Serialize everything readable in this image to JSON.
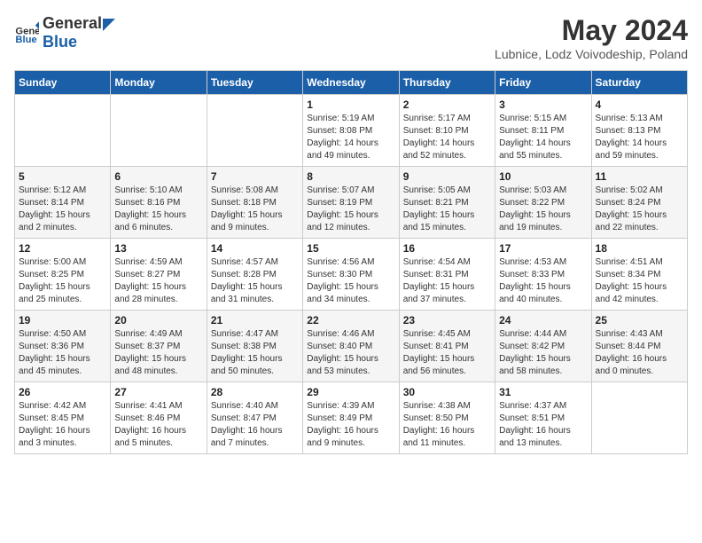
{
  "header": {
    "logo": {
      "general": "General",
      "blue": "Blue"
    },
    "title": "May 2024",
    "location": "Lubnice, Lodz Voivodeship, Poland"
  },
  "weekdays": [
    "Sunday",
    "Monday",
    "Tuesday",
    "Wednesday",
    "Thursday",
    "Friday",
    "Saturday"
  ],
  "weeks": [
    [
      {
        "day": "",
        "info": ""
      },
      {
        "day": "",
        "info": ""
      },
      {
        "day": "",
        "info": ""
      },
      {
        "day": "1",
        "info": "Sunrise: 5:19 AM\nSunset: 8:08 PM\nDaylight: 14 hours\nand 49 minutes."
      },
      {
        "day": "2",
        "info": "Sunrise: 5:17 AM\nSunset: 8:10 PM\nDaylight: 14 hours\nand 52 minutes."
      },
      {
        "day": "3",
        "info": "Sunrise: 5:15 AM\nSunset: 8:11 PM\nDaylight: 14 hours\nand 55 minutes."
      },
      {
        "day": "4",
        "info": "Sunrise: 5:13 AM\nSunset: 8:13 PM\nDaylight: 14 hours\nand 59 minutes."
      }
    ],
    [
      {
        "day": "5",
        "info": "Sunrise: 5:12 AM\nSunset: 8:14 PM\nDaylight: 15 hours\nand 2 minutes."
      },
      {
        "day": "6",
        "info": "Sunrise: 5:10 AM\nSunset: 8:16 PM\nDaylight: 15 hours\nand 6 minutes."
      },
      {
        "day": "7",
        "info": "Sunrise: 5:08 AM\nSunset: 8:18 PM\nDaylight: 15 hours\nand 9 minutes."
      },
      {
        "day": "8",
        "info": "Sunrise: 5:07 AM\nSunset: 8:19 PM\nDaylight: 15 hours\nand 12 minutes."
      },
      {
        "day": "9",
        "info": "Sunrise: 5:05 AM\nSunset: 8:21 PM\nDaylight: 15 hours\nand 15 minutes."
      },
      {
        "day": "10",
        "info": "Sunrise: 5:03 AM\nSunset: 8:22 PM\nDaylight: 15 hours\nand 19 minutes."
      },
      {
        "day": "11",
        "info": "Sunrise: 5:02 AM\nSunset: 8:24 PM\nDaylight: 15 hours\nand 22 minutes."
      }
    ],
    [
      {
        "day": "12",
        "info": "Sunrise: 5:00 AM\nSunset: 8:25 PM\nDaylight: 15 hours\nand 25 minutes."
      },
      {
        "day": "13",
        "info": "Sunrise: 4:59 AM\nSunset: 8:27 PM\nDaylight: 15 hours\nand 28 minutes."
      },
      {
        "day": "14",
        "info": "Sunrise: 4:57 AM\nSunset: 8:28 PM\nDaylight: 15 hours\nand 31 minutes."
      },
      {
        "day": "15",
        "info": "Sunrise: 4:56 AM\nSunset: 8:30 PM\nDaylight: 15 hours\nand 34 minutes."
      },
      {
        "day": "16",
        "info": "Sunrise: 4:54 AM\nSunset: 8:31 PM\nDaylight: 15 hours\nand 37 minutes."
      },
      {
        "day": "17",
        "info": "Sunrise: 4:53 AM\nSunset: 8:33 PM\nDaylight: 15 hours\nand 40 minutes."
      },
      {
        "day": "18",
        "info": "Sunrise: 4:51 AM\nSunset: 8:34 PM\nDaylight: 15 hours\nand 42 minutes."
      }
    ],
    [
      {
        "day": "19",
        "info": "Sunrise: 4:50 AM\nSunset: 8:36 PM\nDaylight: 15 hours\nand 45 minutes."
      },
      {
        "day": "20",
        "info": "Sunrise: 4:49 AM\nSunset: 8:37 PM\nDaylight: 15 hours\nand 48 minutes."
      },
      {
        "day": "21",
        "info": "Sunrise: 4:47 AM\nSunset: 8:38 PM\nDaylight: 15 hours\nand 50 minutes."
      },
      {
        "day": "22",
        "info": "Sunrise: 4:46 AM\nSunset: 8:40 PM\nDaylight: 15 hours\nand 53 minutes."
      },
      {
        "day": "23",
        "info": "Sunrise: 4:45 AM\nSunset: 8:41 PM\nDaylight: 15 hours\nand 56 minutes."
      },
      {
        "day": "24",
        "info": "Sunrise: 4:44 AM\nSunset: 8:42 PM\nDaylight: 15 hours\nand 58 minutes."
      },
      {
        "day": "25",
        "info": "Sunrise: 4:43 AM\nSunset: 8:44 PM\nDaylight: 16 hours\nand 0 minutes."
      }
    ],
    [
      {
        "day": "26",
        "info": "Sunrise: 4:42 AM\nSunset: 8:45 PM\nDaylight: 16 hours\nand 3 minutes."
      },
      {
        "day": "27",
        "info": "Sunrise: 4:41 AM\nSunset: 8:46 PM\nDaylight: 16 hours\nand 5 minutes."
      },
      {
        "day": "28",
        "info": "Sunrise: 4:40 AM\nSunset: 8:47 PM\nDaylight: 16 hours\nand 7 minutes."
      },
      {
        "day": "29",
        "info": "Sunrise: 4:39 AM\nSunset: 8:49 PM\nDaylight: 16 hours\nand 9 minutes."
      },
      {
        "day": "30",
        "info": "Sunrise: 4:38 AM\nSunset: 8:50 PM\nDaylight: 16 hours\nand 11 minutes."
      },
      {
        "day": "31",
        "info": "Sunrise: 4:37 AM\nSunset: 8:51 PM\nDaylight: 16 hours\nand 13 minutes."
      },
      {
        "day": "",
        "info": ""
      }
    ]
  ]
}
